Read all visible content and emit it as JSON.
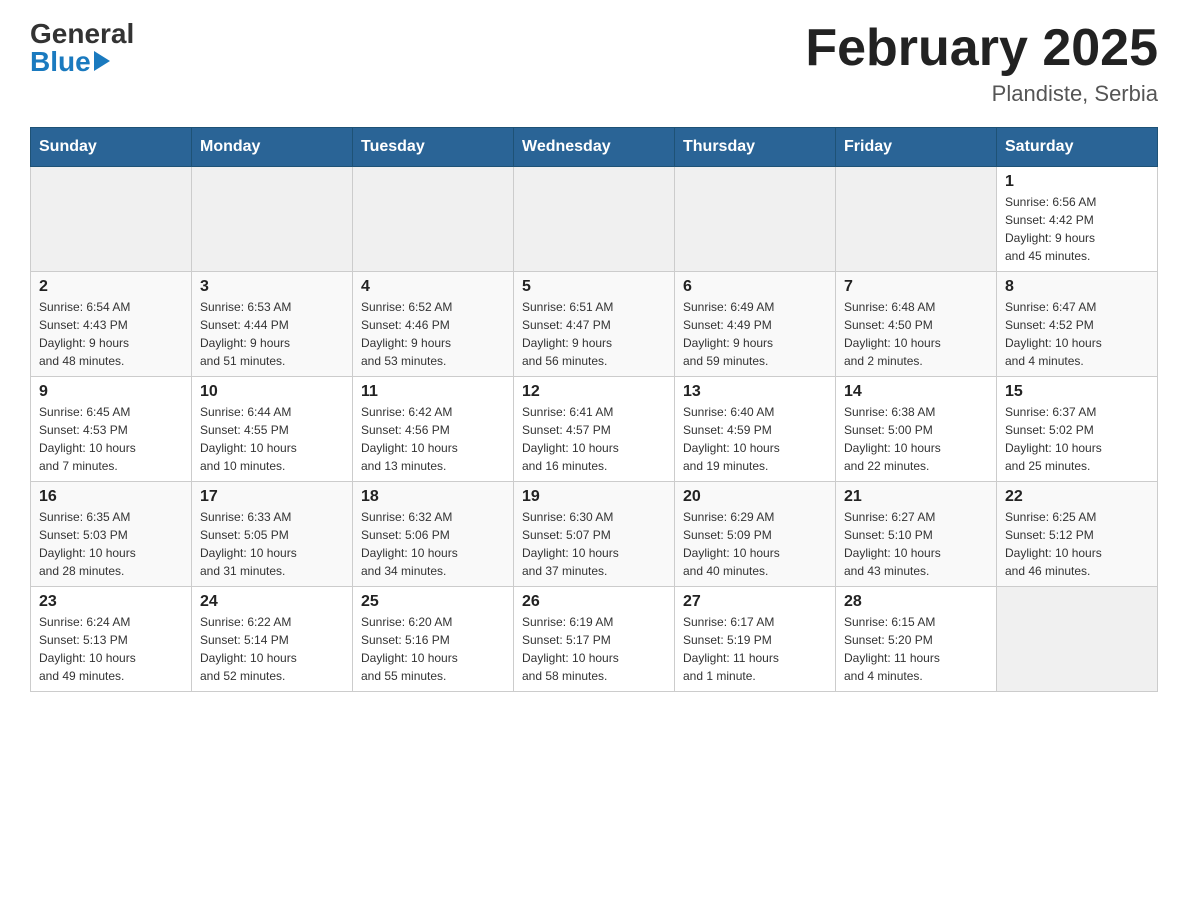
{
  "header": {
    "logo_general": "General",
    "logo_blue": "Blue",
    "month_title": "February 2025",
    "location": "Plandiste, Serbia"
  },
  "days_of_week": [
    "Sunday",
    "Monday",
    "Tuesday",
    "Wednesday",
    "Thursday",
    "Friday",
    "Saturday"
  ],
  "weeks": [
    [
      {
        "day": "",
        "info": ""
      },
      {
        "day": "",
        "info": ""
      },
      {
        "day": "",
        "info": ""
      },
      {
        "day": "",
        "info": ""
      },
      {
        "day": "",
        "info": ""
      },
      {
        "day": "",
        "info": ""
      },
      {
        "day": "1",
        "info": "Sunrise: 6:56 AM\nSunset: 4:42 PM\nDaylight: 9 hours\nand 45 minutes."
      }
    ],
    [
      {
        "day": "2",
        "info": "Sunrise: 6:54 AM\nSunset: 4:43 PM\nDaylight: 9 hours\nand 48 minutes."
      },
      {
        "day": "3",
        "info": "Sunrise: 6:53 AM\nSunset: 4:44 PM\nDaylight: 9 hours\nand 51 minutes."
      },
      {
        "day": "4",
        "info": "Sunrise: 6:52 AM\nSunset: 4:46 PM\nDaylight: 9 hours\nand 53 minutes."
      },
      {
        "day": "5",
        "info": "Sunrise: 6:51 AM\nSunset: 4:47 PM\nDaylight: 9 hours\nand 56 minutes."
      },
      {
        "day": "6",
        "info": "Sunrise: 6:49 AM\nSunset: 4:49 PM\nDaylight: 9 hours\nand 59 minutes."
      },
      {
        "day": "7",
        "info": "Sunrise: 6:48 AM\nSunset: 4:50 PM\nDaylight: 10 hours\nand 2 minutes."
      },
      {
        "day": "8",
        "info": "Sunrise: 6:47 AM\nSunset: 4:52 PM\nDaylight: 10 hours\nand 4 minutes."
      }
    ],
    [
      {
        "day": "9",
        "info": "Sunrise: 6:45 AM\nSunset: 4:53 PM\nDaylight: 10 hours\nand 7 minutes."
      },
      {
        "day": "10",
        "info": "Sunrise: 6:44 AM\nSunset: 4:55 PM\nDaylight: 10 hours\nand 10 minutes."
      },
      {
        "day": "11",
        "info": "Sunrise: 6:42 AM\nSunset: 4:56 PM\nDaylight: 10 hours\nand 13 minutes."
      },
      {
        "day": "12",
        "info": "Sunrise: 6:41 AM\nSunset: 4:57 PM\nDaylight: 10 hours\nand 16 minutes."
      },
      {
        "day": "13",
        "info": "Sunrise: 6:40 AM\nSunset: 4:59 PM\nDaylight: 10 hours\nand 19 minutes."
      },
      {
        "day": "14",
        "info": "Sunrise: 6:38 AM\nSunset: 5:00 PM\nDaylight: 10 hours\nand 22 minutes."
      },
      {
        "day": "15",
        "info": "Sunrise: 6:37 AM\nSunset: 5:02 PM\nDaylight: 10 hours\nand 25 minutes."
      }
    ],
    [
      {
        "day": "16",
        "info": "Sunrise: 6:35 AM\nSunset: 5:03 PM\nDaylight: 10 hours\nand 28 minutes."
      },
      {
        "day": "17",
        "info": "Sunrise: 6:33 AM\nSunset: 5:05 PM\nDaylight: 10 hours\nand 31 minutes."
      },
      {
        "day": "18",
        "info": "Sunrise: 6:32 AM\nSunset: 5:06 PM\nDaylight: 10 hours\nand 34 minutes."
      },
      {
        "day": "19",
        "info": "Sunrise: 6:30 AM\nSunset: 5:07 PM\nDaylight: 10 hours\nand 37 minutes."
      },
      {
        "day": "20",
        "info": "Sunrise: 6:29 AM\nSunset: 5:09 PM\nDaylight: 10 hours\nand 40 minutes."
      },
      {
        "day": "21",
        "info": "Sunrise: 6:27 AM\nSunset: 5:10 PM\nDaylight: 10 hours\nand 43 minutes."
      },
      {
        "day": "22",
        "info": "Sunrise: 6:25 AM\nSunset: 5:12 PM\nDaylight: 10 hours\nand 46 minutes."
      }
    ],
    [
      {
        "day": "23",
        "info": "Sunrise: 6:24 AM\nSunset: 5:13 PM\nDaylight: 10 hours\nand 49 minutes."
      },
      {
        "day": "24",
        "info": "Sunrise: 6:22 AM\nSunset: 5:14 PM\nDaylight: 10 hours\nand 52 minutes."
      },
      {
        "day": "25",
        "info": "Sunrise: 6:20 AM\nSunset: 5:16 PM\nDaylight: 10 hours\nand 55 minutes."
      },
      {
        "day": "26",
        "info": "Sunrise: 6:19 AM\nSunset: 5:17 PM\nDaylight: 10 hours\nand 58 minutes."
      },
      {
        "day": "27",
        "info": "Sunrise: 6:17 AM\nSunset: 5:19 PM\nDaylight: 11 hours\nand 1 minute."
      },
      {
        "day": "28",
        "info": "Sunrise: 6:15 AM\nSunset: 5:20 PM\nDaylight: 11 hours\nand 4 minutes."
      },
      {
        "day": "",
        "info": ""
      }
    ]
  ]
}
